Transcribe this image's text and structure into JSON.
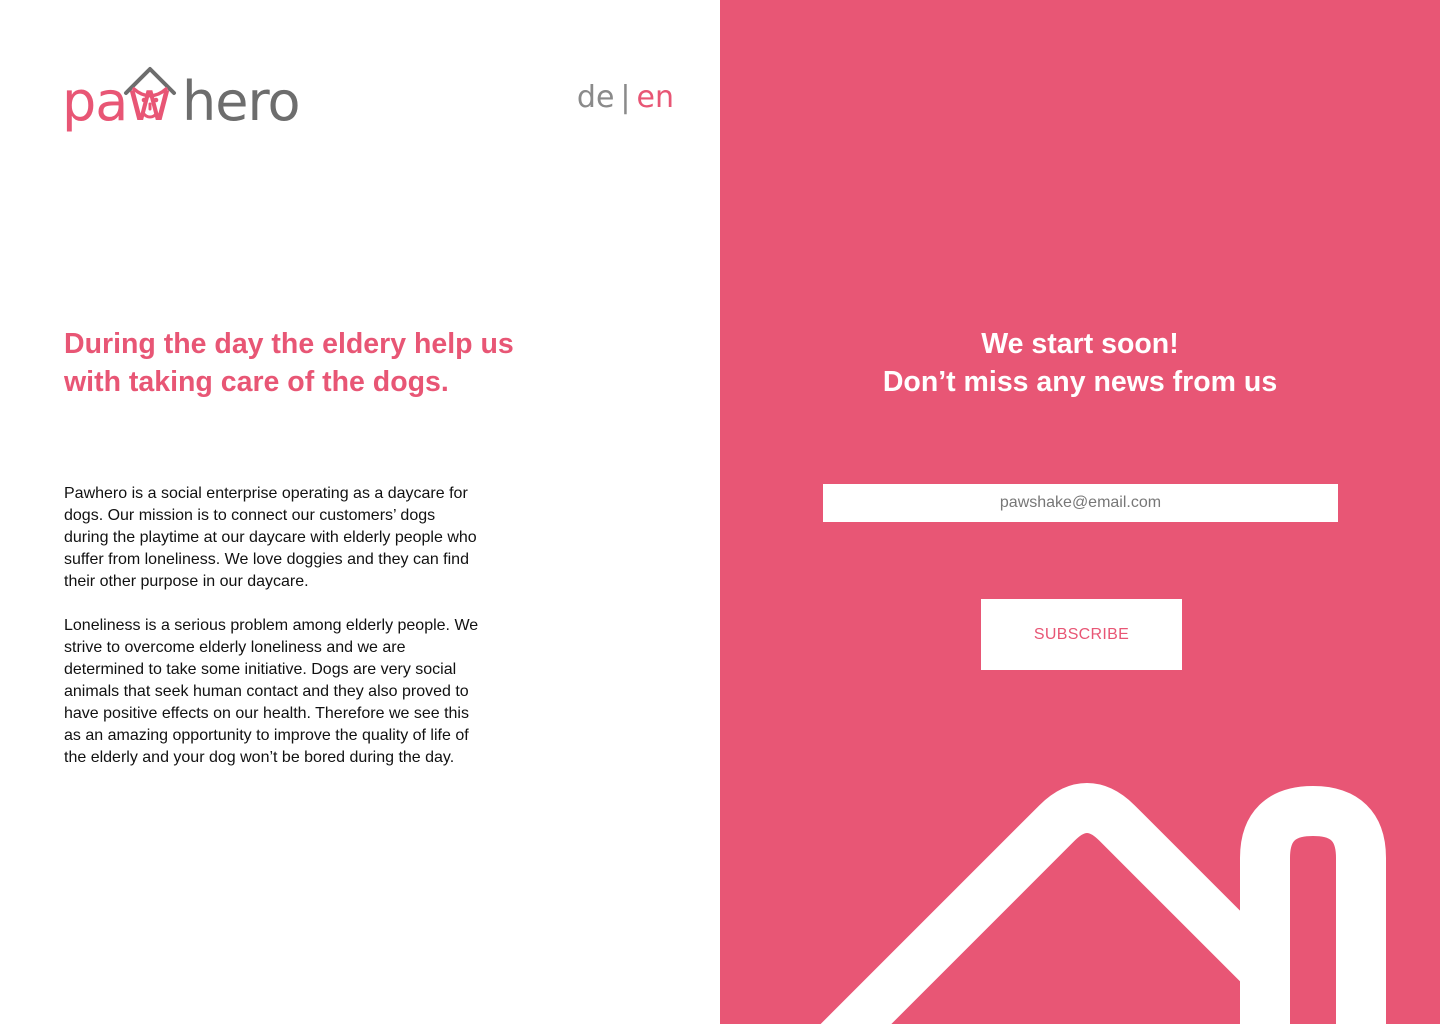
{
  "brand": {
    "name_part1": "paw",
    "name_part2": "hero",
    "mark_icon": "dog-house-icon",
    "colors": {
      "primary": "#e85675",
      "secondary": "#6d6d6d"
    }
  },
  "language_switch": {
    "de": "de",
    "separator": "|",
    "en": "en",
    "active": "en"
  },
  "left": {
    "headline": "During the day the eldery help us with taking care of the dogs.",
    "paragraphs": [
      "Pawhero is a social enterprise operating as a daycare for dogs. Our mission is to connect our customers’ dogs during the playtime at our daycare with elderly people who suffer from loneliness. We love doggies and they can find their other purpose in our daycare.",
      "Loneliness is a serious problem among elderly people. We strive to overcome elderly loneliness and we are determined to take some initiative. Dogs are very social animals that seek human contact and they also proved to have positive effects on our health. Therefore we see this as an amazing opportunity to improve the quality of life of the elderly and your dog won’t be bored during the day."
    ]
  },
  "right": {
    "cta_line1": "We start soon!",
    "cta_line2": "Don’t miss any news from us",
    "email_placeholder": "pawshake@email.com",
    "email_value": "",
    "subscribe_label": "SUBSCRIBE",
    "decoration_icon": "house-outline-icon",
    "background_color": "#e85675"
  }
}
